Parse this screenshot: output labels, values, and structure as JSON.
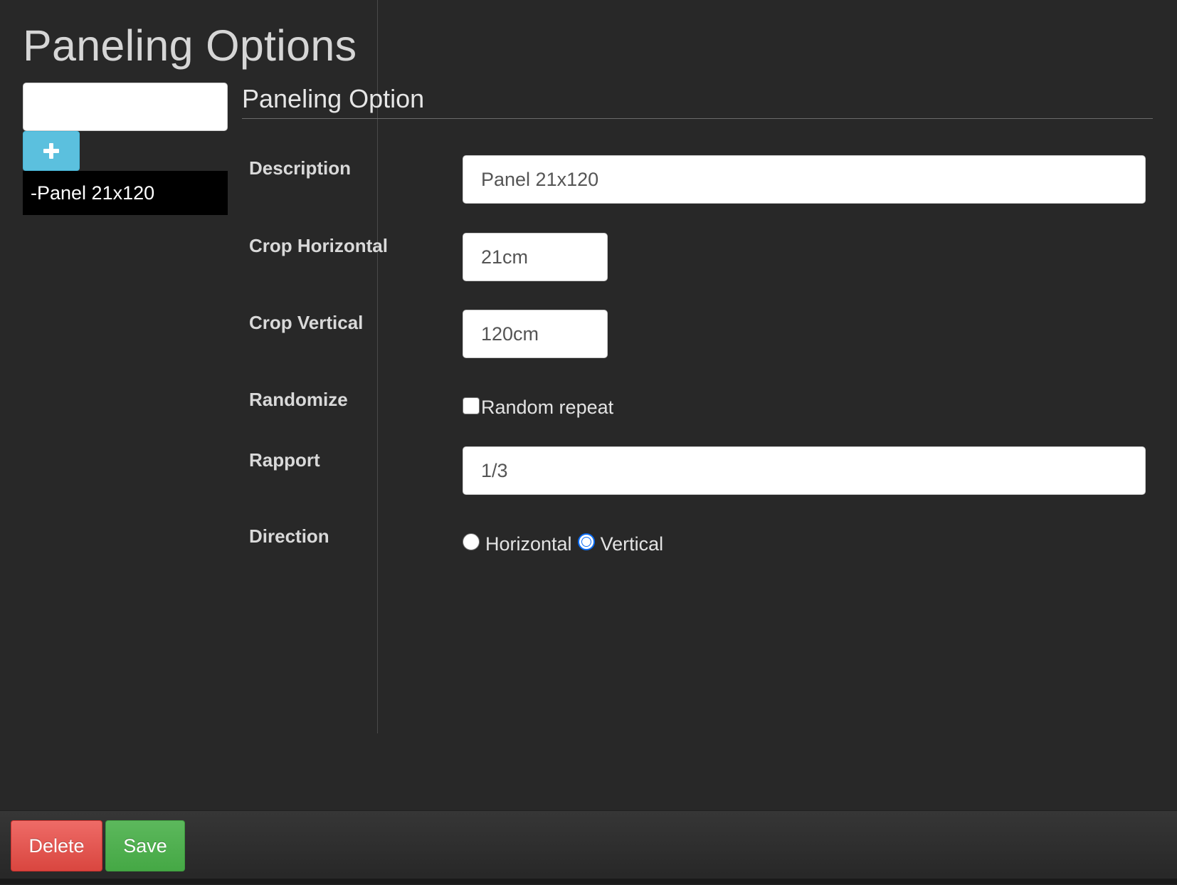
{
  "header": {
    "title": "Paneling Options"
  },
  "sidebar": {
    "new_option_value": "",
    "add_icon": "plus-icon",
    "items": [
      {
        "label": "-Panel 21x120"
      }
    ]
  },
  "form": {
    "section_title": "Paneling Option",
    "description": {
      "label": "Description",
      "value": "Panel 21x120"
    },
    "crop_horizontal": {
      "label": "Crop Horizontal",
      "value": "21cm"
    },
    "crop_vertical": {
      "label": "Crop Vertical",
      "value": "120cm"
    },
    "randomize": {
      "label": "Randomize",
      "checkbox_label": "Random repeat",
      "checked": false
    },
    "rapport": {
      "label": "Rapport",
      "value": "1/3"
    },
    "direction": {
      "label": "Direction",
      "options": [
        {
          "label": "Horizontal",
          "selected": false
        },
        {
          "label": "Vertical",
          "selected": true
        }
      ]
    }
  },
  "footer": {
    "delete_label": "Delete",
    "save_label": "Save"
  },
  "colors": {
    "background": "#282828",
    "add_button": "#5bc0de",
    "delete_button": "#d9534f",
    "save_button": "#5cb85c",
    "selected_list_item": "#000000",
    "radio_accent": "#0a6cf5"
  }
}
